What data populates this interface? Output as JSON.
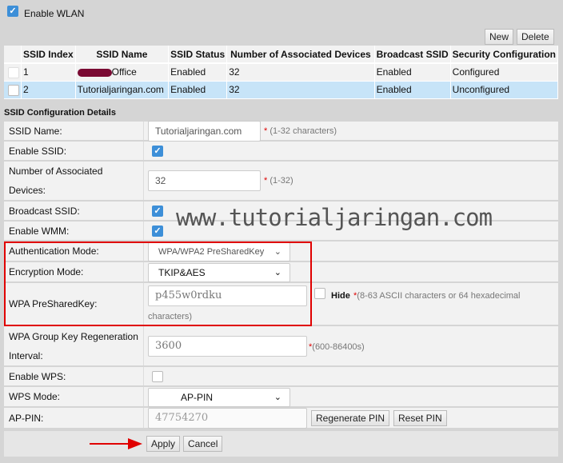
{
  "enable_wlan": {
    "label": "Enable WLAN",
    "checked": true
  },
  "toolbar": {
    "new": "New",
    "delete": "Delete"
  },
  "table": {
    "headers": [
      "",
      "SSID Index",
      "SSID Name",
      "SSID Status",
      "Number of Associated Devices",
      "Broadcast SSID",
      "Security Configuration"
    ],
    "rows": [
      {
        "index": "1",
        "name": "Office",
        "status": "Enabled",
        "devices": "32",
        "broadcast": "Enabled",
        "security": "Configured"
      },
      {
        "index": "2",
        "name": "Tutorialjaringan.com",
        "status": "Enabled",
        "devices": "32",
        "broadcast": "Enabled",
        "security": "Unconfigured"
      }
    ]
  },
  "section_title": "SSID Configuration Details",
  "form": {
    "ssid_name": {
      "label": "SSID Name:",
      "value": "Tutorialjaringan.com",
      "hint": "(1-32 characters)"
    },
    "enable_ssid": {
      "label": "Enable SSID:",
      "checked": true
    },
    "num_devices": {
      "label": "Number of Associated Devices:",
      "value": "32",
      "hint": "(1-32)"
    },
    "broadcast": {
      "label": "Broadcast SSID:",
      "checked": true
    },
    "wmm": {
      "label": "Enable WMM:",
      "checked": true
    },
    "auth": {
      "label": "Authentication Mode:",
      "value": "WPA/WPA2 PreSharedKey"
    },
    "enc": {
      "label": "Encryption Mode:",
      "value": "TKIP&AES"
    },
    "psk": {
      "label": "WPA PreSharedKey:",
      "value": "p455w0rdku",
      "hide": "Hide",
      "hint": "(8-63 ASCII characters or 64 hexadecimal",
      "hint2": "characters)"
    },
    "group": {
      "label": "WPA Group Key Regeneration Interval:",
      "value": "3600",
      "hint": "(600-86400s)"
    },
    "wps": {
      "label": "Enable WPS:",
      "checked": false
    },
    "wps_mode": {
      "label": "WPS Mode:",
      "value": "AP-PIN"
    },
    "ap_pin": {
      "label": "AP-PIN:",
      "value": "47754270",
      "regen": "Regenerate PIN",
      "reset": "Reset PIN"
    }
  },
  "actions": {
    "apply": "Apply",
    "cancel": "Cancel"
  },
  "watermark": "www.tutorialjaringan.com",
  "colors": {
    "highlight_box": "#e00000",
    "arrow": "#e00000",
    "selected_row": "#c7e4f8",
    "checkbox": "#3d8fd8"
  }
}
